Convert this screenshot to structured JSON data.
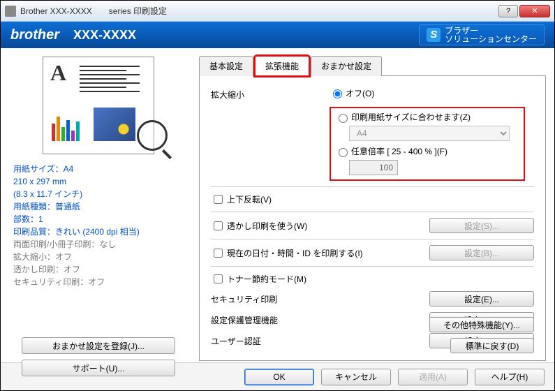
{
  "title": "Brother XXX-XXXX　　series 印刷設定",
  "brand": {
    "logo": "brother",
    "model": "XXX-XXXX",
    "solution_line1": "ブラザー",
    "solution_line2": "ソリューションセンター"
  },
  "tabs": {
    "basic": "基本設定",
    "advanced": "拡張機能",
    "auto": "おまかせ設定"
  },
  "left": {
    "paper_size": "用紙サイズ：A4",
    "paper_dim_mm": "210 x 297 mm",
    "paper_dim_in": "(8.3 x 11.7 インチ)",
    "paper_type": "用紙種類：普通紙",
    "copies": "部数：1",
    "quality": "印刷品質：きれい (2400 dpi 相当)",
    "duplex": "両面印刷/小冊子印刷：なし",
    "scaling": "拡大縮小：オフ",
    "watermark": "透かし印刷：オフ",
    "security": "セキュリティ印刷：オフ",
    "save_auto_btn": "おまかせ設定を登録(J)...",
    "support_btn": "サポート(U)..."
  },
  "main": {
    "scaling_label": "拡大縮小",
    "scaling_off": "オフ(O)",
    "scaling_fit": "印刷用紙サイズに合わせます(Z)",
    "scaling_fit_value": "A4",
    "scaling_ratio": "任意倍率 [ 25 - 400 % ](F)",
    "scaling_ratio_value": "100",
    "flip": "上下反転(V)",
    "watermark": "透かし印刷を使う(W)",
    "watermark_btn": "設定(S)...",
    "datetime": "現在の日付・時間・ID を印刷する(I)",
    "datetime_btn": "設定(B)...",
    "toner": "トナー節約モード(M)",
    "security": "セキュリティ印刷",
    "security_btn": "設定(E)...",
    "admin": "設定保護管理機能",
    "admin_btn": "設定(N)...",
    "userauth": "ユーザー認証",
    "userauth_btn": "設定(T)...",
    "other_btn": "その他特殊機能(Y)...",
    "restore_btn": "標準に戻す(D)"
  },
  "footer": {
    "ok": "OK",
    "cancel": "キャンセル",
    "apply": "適用(A)",
    "help": "ヘルプ(H)"
  }
}
